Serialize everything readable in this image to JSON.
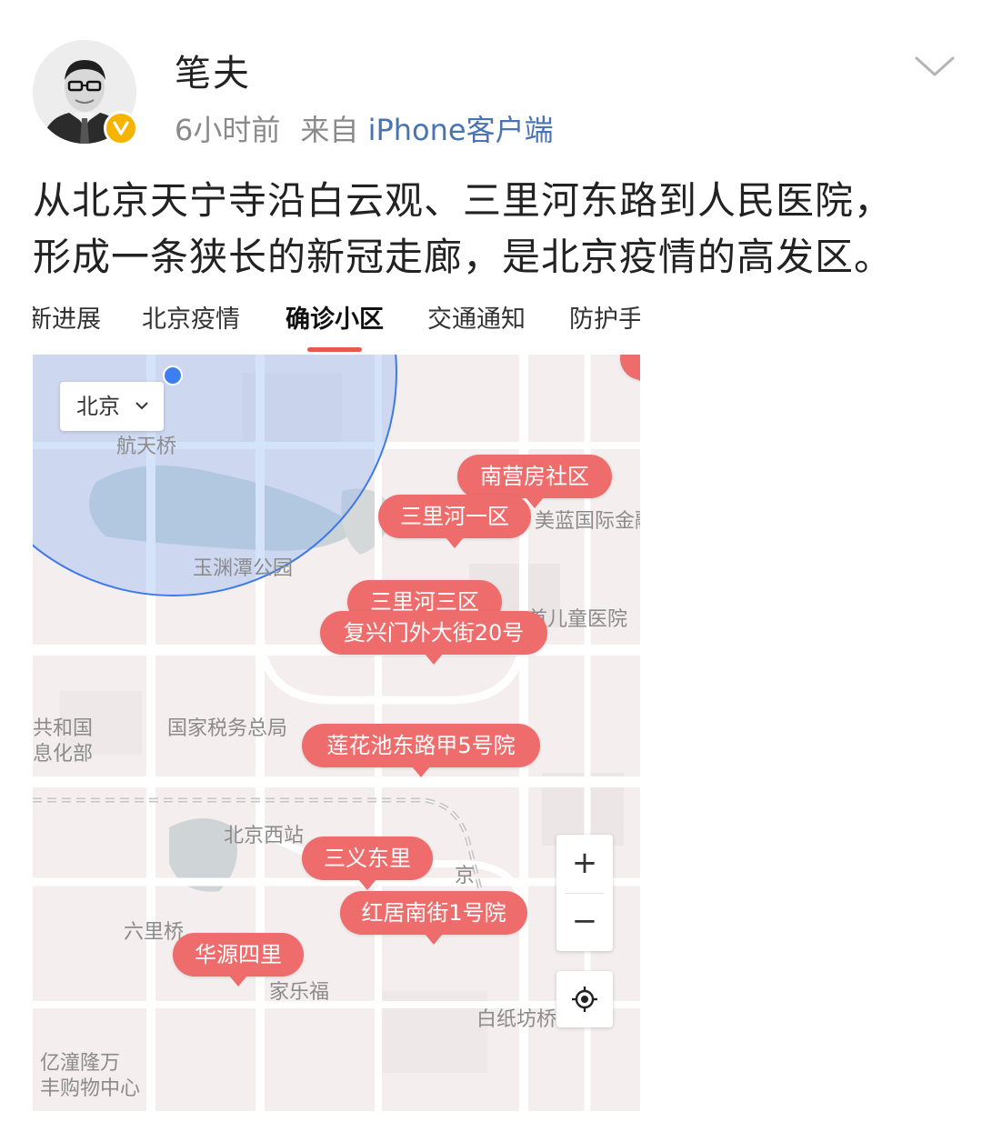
{
  "post": {
    "author": "笔夫",
    "time": "6小时前",
    "source_prefix": "来自",
    "source_app": "iPhone客户端",
    "text_line1": "从北京天宁寺沿白云观、三里河东路到人民医院，",
    "text_line2": "形成一条狭长的新冠走廊，是北京疫情的高发区。"
  },
  "tabs": [
    {
      "label": "新进展",
      "active": false
    },
    {
      "label": "北京疫情",
      "active": false
    },
    {
      "label": "确诊小区",
      "active": true
    },
    {
      "label": "交通通知",
      "active": false
    },
    {
      "label": "防护手",
      "active": false
    }
  ],
  "map": {
    "city_selector": "北京",
    "labels": {
      "hangtianqiao": "航天桥",
      "yuyuantan": "玉渊潭公园",
      "ertong": "首儿童医院",
      "shuiwu": "国家税务总局",
      "gongheguo": "共和国",
      "xinxihua": "息化部",
      "xizhan": "北京西站",
      "jing": "京",
      "liliqiao": "六里桥",
      "jialefu": "家乐福",
      "baizhifang": "白纸坊桥",
      "yitong1": "亿潼隆万",
      "yitong2": "丰购物中心",
      "jinrong": "美蓝国际金融"
    },
    "pins": {
      "nanying": "南营房社区",
      "sanli1": "三里河一区",
      "sanli3": "三里河三区",
      "fuxing": "复兴门外大街20号",
      "lianhua": "莲花池东路甲5号院",
      "sanyi": "三义东里",
      "hongju": "红居南街1号院",
      "huayuan": "华源四里"
    },
    "zoom_in": "+",
    "zoom_out": "−"
  },
  "colors": {
    "pin": "#ee6c6b",
    "accent": "#e8584f",
    "link": "#4a73b4",
    "badge": "#f5b400"
  }
}
